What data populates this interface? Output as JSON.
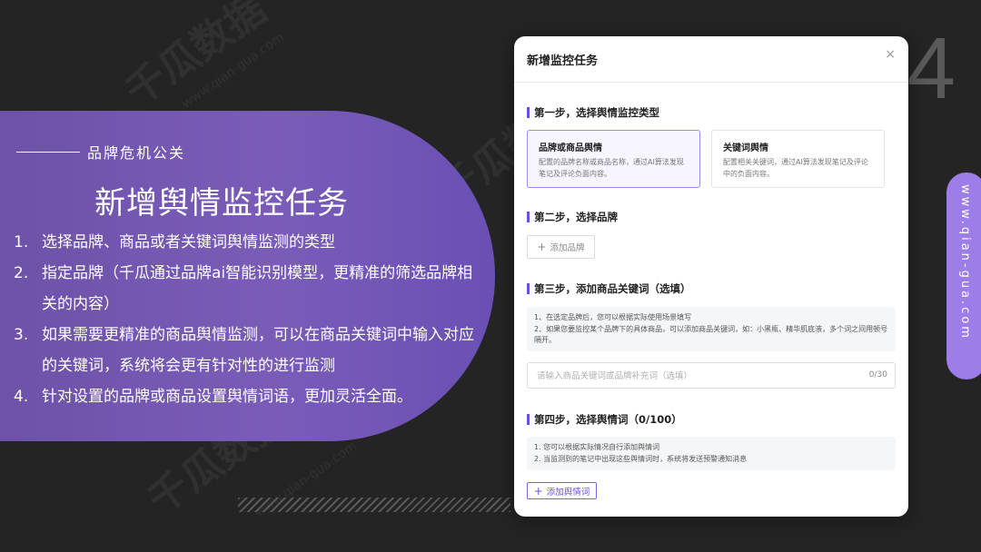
{
  "watermark": {
    "brand_cn": "千瓜数据",
    "brand_url": "www.qian-gua.com"
  },
  "slide": {
    "page_number": "4",
    "side_url": "www.qian-gua.com"
  },
  "left": {
    "subtitle": "品牌危机公关",
    "title": "新增舆情监控任务",
    "items": [
      {
        "num": "1.",
        "text": "选择品牌、商品或者关键词舆情监测的类型"
      },
      {
        "num": "2.",
        "text": "指定品牌（千瓜通过品牌ai智能识别模型，更精准的筛选品牌相关的内容）"
      },
      {
        "num": "3.",
        "text": "如果需要更精准的商品舆情监测，可以在商品关键词中输入对应的关键词，系统将会更有针对性的进行监测"
      },
      {
        "num": "4.",
        "text": "针对设置的品牌或商品设置舆情词语，更加灵活全面。"
      }
    ]
  },
  "modal": {
    "title": "新增监控任务",
    "close": "×",
    "step1": {
      "title": "第一步，选择舆情监控类型",
      "cards": [
        {
          "title": "品牌或商品舆情",
          "desc": "配置的品牌名称或商品名称，通过AI算法发现笔记及评论负面内容。",
          "selected": true
        },
        {
          "title": "关键词舆情",
          "desc": "配置相关关键词，通过AI算法发现笔记及评论中的负面内容。",
          "selected": false
        }
      ]
    },
    "step2": {
      "title": "第二步，选择品牌",
      "add_label": "添加品牌"
    },
    "step3": {
      "title": "第三步，添加商品关键词（选填）",
      "notes": [
        "1、在选定品牌后，您可以根据实际使用场景填写",
        "2、如果您要监控某个品牌下的具体商品，可以添加商品关键词，如：小黑瓶、精华肌底液，多个词之间用顿号隔开。"
      ],
      "placeholder": "请输入商品关键词或品牌补充词（选填）",
      "value": "",
      "count": "0/30"
    },
    "step4": {
      "title": "第四步，选择舆情词（0/100）",
      "notes": [
        "1. 您可以根据实际情况自行添加舆情词",
        "2. 当监测到的笔记中出现这些舆情词时，系统将发送预警通知消息"
      ],
      "add_label": "添加舆情词"
    }
  },
  "colors": {
    "background": "#242424",
    "panel_purple": "#7a5cb8",
    "accent": "#6c4fe0",
    "side_pill": "#9d7ee8"
  }
}
